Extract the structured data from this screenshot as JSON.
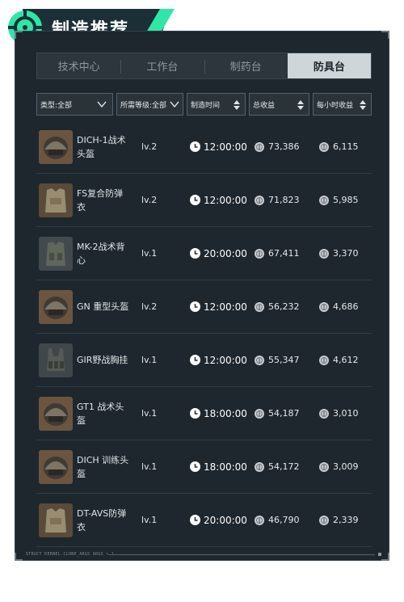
{
  "header": {
    "title": "制造推荐",
    "icon": "crosshair-icon",
    "accent_color": "#2fe6a6"
  },
  "tabs": [
    {
      "label": "技术中心",
      "active": false
    },
    {
      "label": "工作台",
      "active": false
    },
    {
      "label": "制药台",
      "active": false
    },
    {
      "label": "防具台",
      "active": true
    }
  ],
  "filters": {
    "type": "类型:全部",
    "level": "所需等级:全部",
    "time": "制造时间",
    "total": "总收益",
    "per_hour": "每小时收益"
  },
  "items": [
    {
      "name": "DICH-1战术头盔",
      "level": "lv.2",
      "time": "12:00:00",
      "total": "73,386",
      "per_hour": "6,115",
      "icon": "helmet-icon"
    },
    {
      "name": "FS复合防弹衣",
      "level": "lv.2",
      "time": "12:00:00",
      "total": "71,823",
      "per_hour": "5,985",
      "icon": "body-armor-icon"
    },
    {
      "name": "MK-2战术背心",
      "level": "lv.1",
      "time": "20:00:00",
      "total": "67,411",
      "per_hour": "3,370",
      "icon": "tactical-vest-icon"
    },
    {
      "name": "GN 重型头盔",
      "level": "lv.2",
      "time": "12:00:00",
      "total": "56,232",
      "per_hour": "4,686",
      "icon": "helmet-icon"
    },
    {
      "name": "GIR野战胸挂",
      "level": "lv.1",
      "time": "12:00:00",
      "total": "55,347",
      "per_hour": "4,612",
      "icon": "chest-rig-icon"
    },
    {
      "name": "GT1 战术头盔",
      "level": "lv.1",
      "time": "18:00:00",
      "total": "54,187",
      "per_hour": "3,010",
      "icon": "helmet-icon"
    },
    {
      "name": "DICH 训练头盔",
      "level": "lv.1",
      "time": "18:00:00",
      "total": "54,172",
      "per_hour": "3,009",
      "icon": "helmet-icon"
    },
    {
      "name": "DT-AVS防弹衣",
      "level": "lv.1",
      "time": "20:00:00",
      "total": "46,790",
      "per_hour": "2,339",
      "icon": "body-armor-icon"
    }
  ],
  "footer": {
    "text": "STRUCT KERNEL.CLONE_ARGS ARGS • 1"
  }
}
